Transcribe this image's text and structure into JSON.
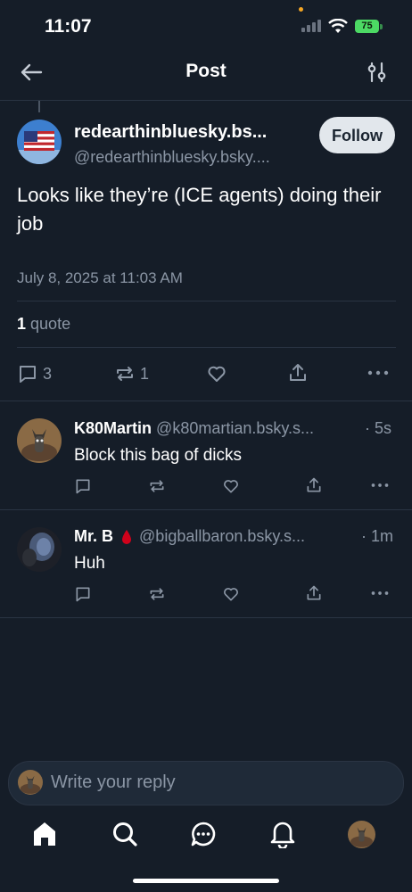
{
  "status_bar": {
    "time": "11:07",
    "battery": "75"
  },
  "header": {
    "title": "Post"
  },
  "post": {
    "author_name": "redearthinbluesky.bs...",
    "author_handle": "@redearthinbluesky.bsky....",
    "follow_label": "Follow",
    "text": "Looks like they’re (ICE agents) doing their job",
    "date": "July 8, 2025 at 11:03 AM",
    "quote_count": "1",
    "quote_label": "quote",
    "reply_count": "3",
    "repost_count": "1"
  },
  "replies": [
    {
      "name": "K80Martin",
      "handle": "@k80martian.bsky.s...",
      "time": "· 5s",
      "text": "Block this bag of dicks"
    },
    {
      "name": "Mr. B",
      "handle": "@bigballbaron.bsky.s...",
      "time": "· 1m",
      "text": "Huh"
    }
  ],
  "composer": {
    "placeholder": "Write your reply"
  },
  "colors": {
    "background": "#151d28",
    "muted": "#8b96a5",
    "follow_bg": "#e2e7ec",
    "battery": "#4cd964",
    "drop": "#d0021b"
  },
  "icons": [
    "back-arrow-icon",
    "filter-icon",
    "reply-icon",
    "repost-icon",
    "like-icon",
    "share-icon",
    "more-icon",
    "home-icon",
    "search-icon",
    "chat-icon",
    "bell-icon",
    "drop-emoji-icon"
  ]
}
